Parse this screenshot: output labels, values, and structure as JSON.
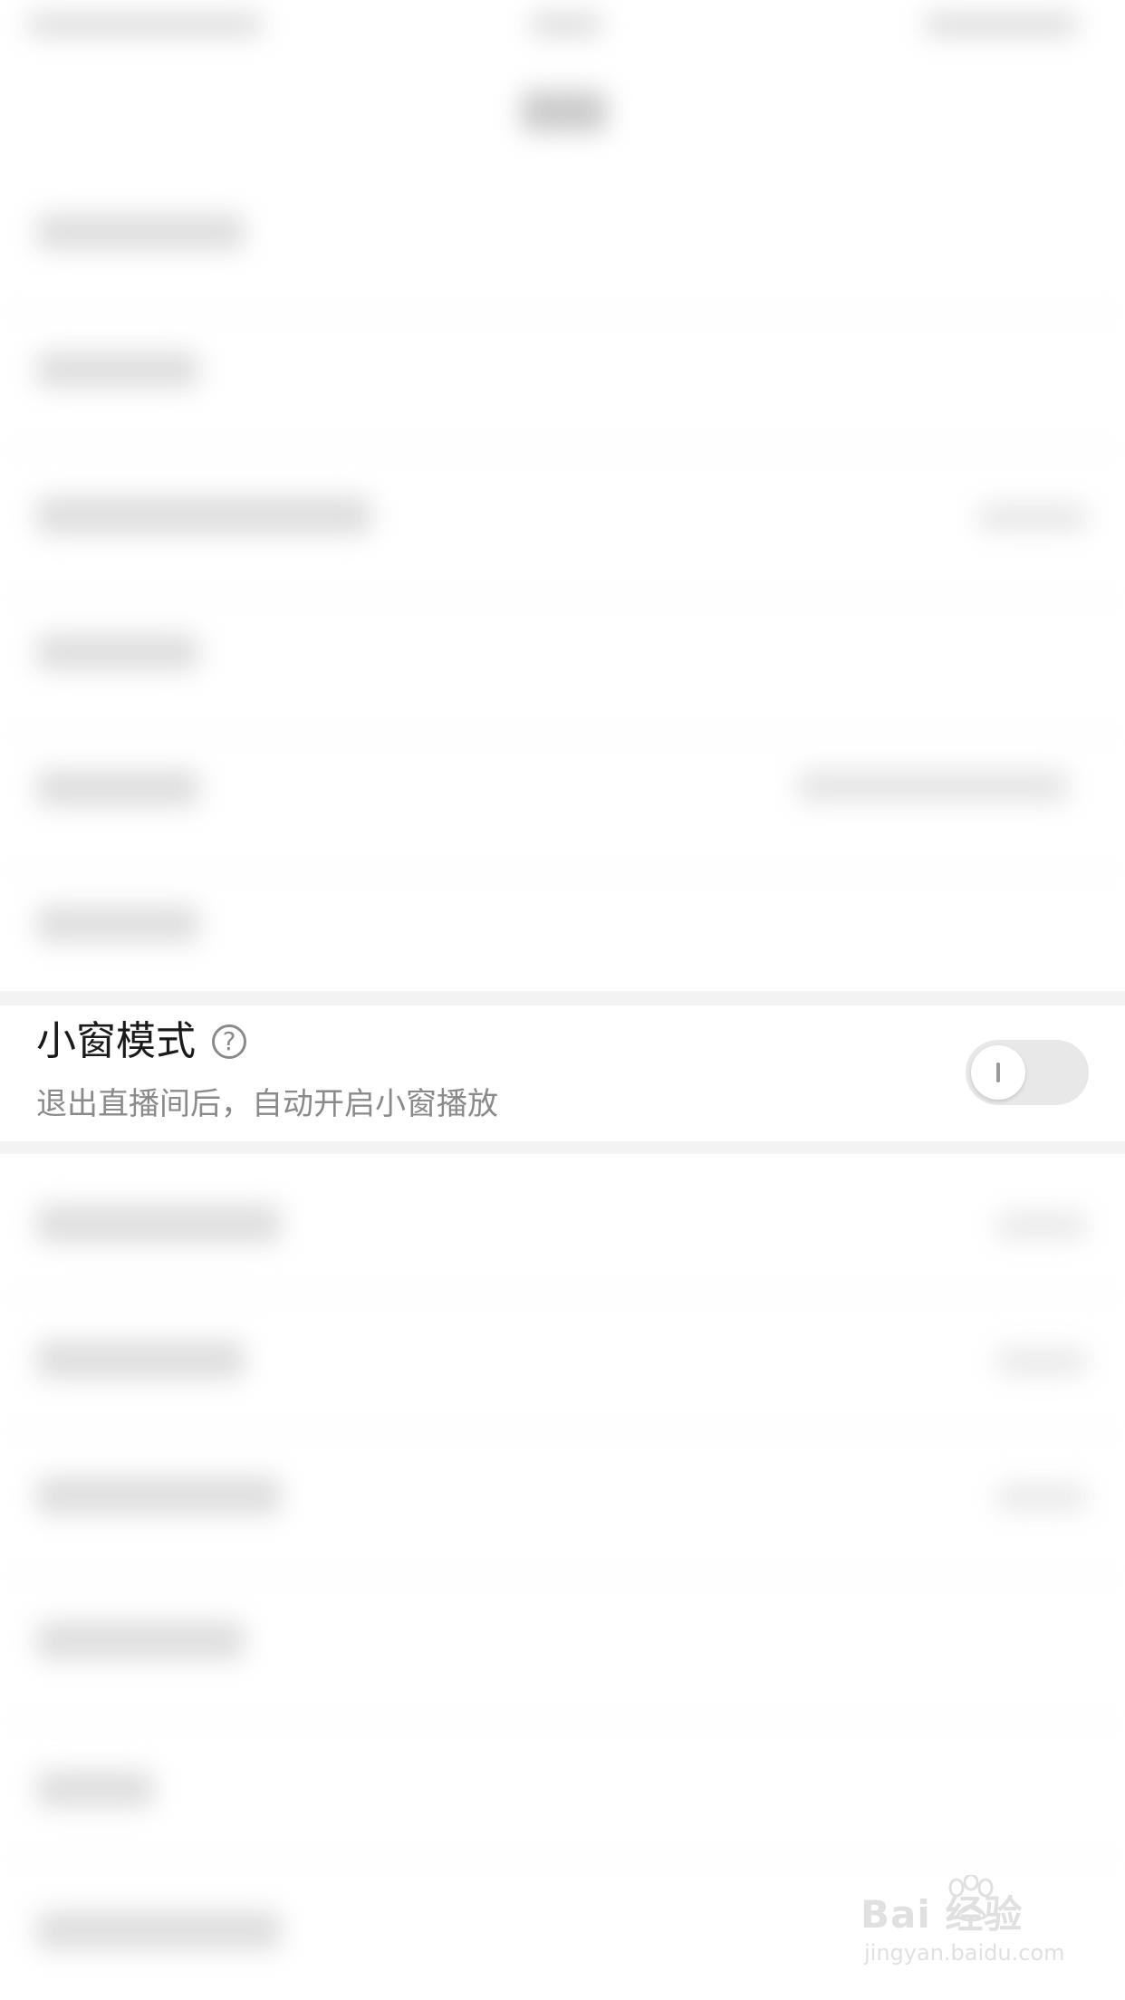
{
  "setting": {
    "title": "小窗模式",
    "subtitle": "退出直播间后，自动开启小窗播放",
    "toggle_state": "off"
  },
  "watermark": {
    "brand": "Bai  经验",
    "url": "jingyan.baidu.com"
  },
  "icons": {
    "help": "question-circle-icon",
    "paw": "baidu-paw-icon"
  },
  "colors": {
    "title": "#1a1a1a",
    "subtitle": "#8a8a8a",
    "toggle_track": "#e8e8e8",
    "separator": "#f3f3f3"
  }
}
